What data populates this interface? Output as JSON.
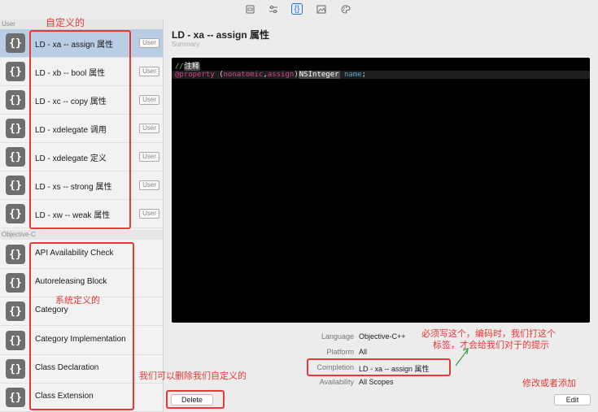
{
  "toolbar": {
    "icons": [
      "file-icon",
      "sliders-icon",
      "braces-icon",
      "image-icon",
      "palette-icon"
    ]
  },
  "sidebar": {
    "user_header": "User",
    "user_items": [
      {
        "label": "LD - xa -- assign 属性",
        "badge": "User"
      },
      {
        "label": "LD - xb -- bool 属性",
        "badge": "User"
      },
      {
        "label": "LD - xc -- copy 属性",
        "badge": "User"
      },
      {
        "label": "LD - xdelegate 调用",
        "badge": "User"
      },
      {
        "label": "LD - xdelegate 定义",
        "badge": "User"
      },
      {
        "label": "LD - xs -- strong 属性",
        "badge": "User"
      },
      {
        "label": "LD - xw -- weak  属性",
        "badge": "User"
      }
    ],
    "objc_header": "Objective-C",
    "objc_items": [
      {
        "label": "API Availability Check"
      },
      {
        "label": "Autoreleasing Block"
      },
      {
        "label": "Category"
      },
      {
        "label": "Category Implementation"
      },
      {
        "label": "Class Declaration"
      },
      {
        "label": "Class Extension"
      }
    ]
  },
  "detail": {
    "title": "LD - xa -- assign 属性",
    "subtitle": "Summary",
    "code": {
      "line1_comment": "//",
      "line1_placeholder": "注释",
      "line2_kw1": "@property",
      "line2_p1": " (",
      "line2_kw2": "nonatomic",
      "line2_p2": ",",
      "line2_kw3": "assign",
      "line2_p3": ")",
      "line2_placeholder": "NSInteger",
      "line2_sp": " ",
      "line2_var": "name",
      "line2_semi": ";"
    },
    "properties": [
      {
        "key": "Language",
        "value": "Objective-C++"
      },
      {
        "key": "Platform",
        "value": "All"
      },
      {
        "key": "Completion",
        "value": "LD - xa -- assign 属性"
      },
      {
        "key": "Availability",
        "value": "All Scopes"
      }
    ],
    "delete_label": "Delete",
    "edit_label": "Edit"
  },
  "annotations": {
    "custom": "自定义的",
    "system": "系统定义的",
    "delete_hint": "我们可以删除我们自定义的",
    "completion_hint_1": "必须写这个，编码时，我们打这个",
    "completion_hint_2": "标签，才会给我们对于的提示",
    "edit_hint": "修改或者添加"
  },
  "colors": {
    "annotation_red": "#e53935",
    "selection": "#b9cde4",
    "accent_blue": "#1f6feb",
    "arrow_green": "#2e9e3f"
  }
}
